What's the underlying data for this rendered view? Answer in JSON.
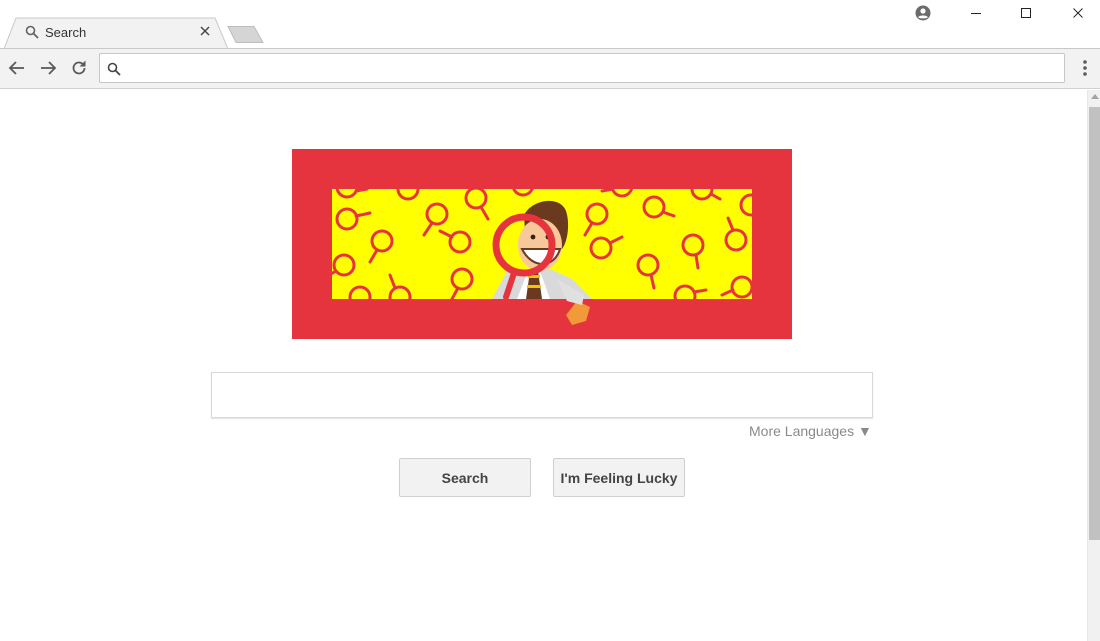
{
  "tab": {
    "title": "Search"
  },
  "omnibox": {
    "value": "",
    "placeholder": ""
  },
  "search": {
    "value": "",
    "placeholder": ""
  },
  "links": {
    "more_languages": "More Languages ▼"
  },
  "buttons": {
    "search_label": "Search",
    "lucky_label": "I'm Feeling Lucky"
  },
  "icons": {
    "tab_favicon": "search-icon",
    "tab_close": "close-icon",
    "profile": "account-circle-icon",
    "minimize": "minimize-icon",
    "maximize": "maximize-icon",
    "close": "close-icon",
    "back": "arrow-left-icon",
    "forward": "arrow-right-icon",
    "reload": "reload-icon",
    "omnibox": "search-icon",
    "menu": "more-vert-icon"
  },
  "colors": {
    "logo_frame": "#e6343f",
    "logo_fill": "#ffff00",
    "logo_loops": "#e6343f"
  }
}
